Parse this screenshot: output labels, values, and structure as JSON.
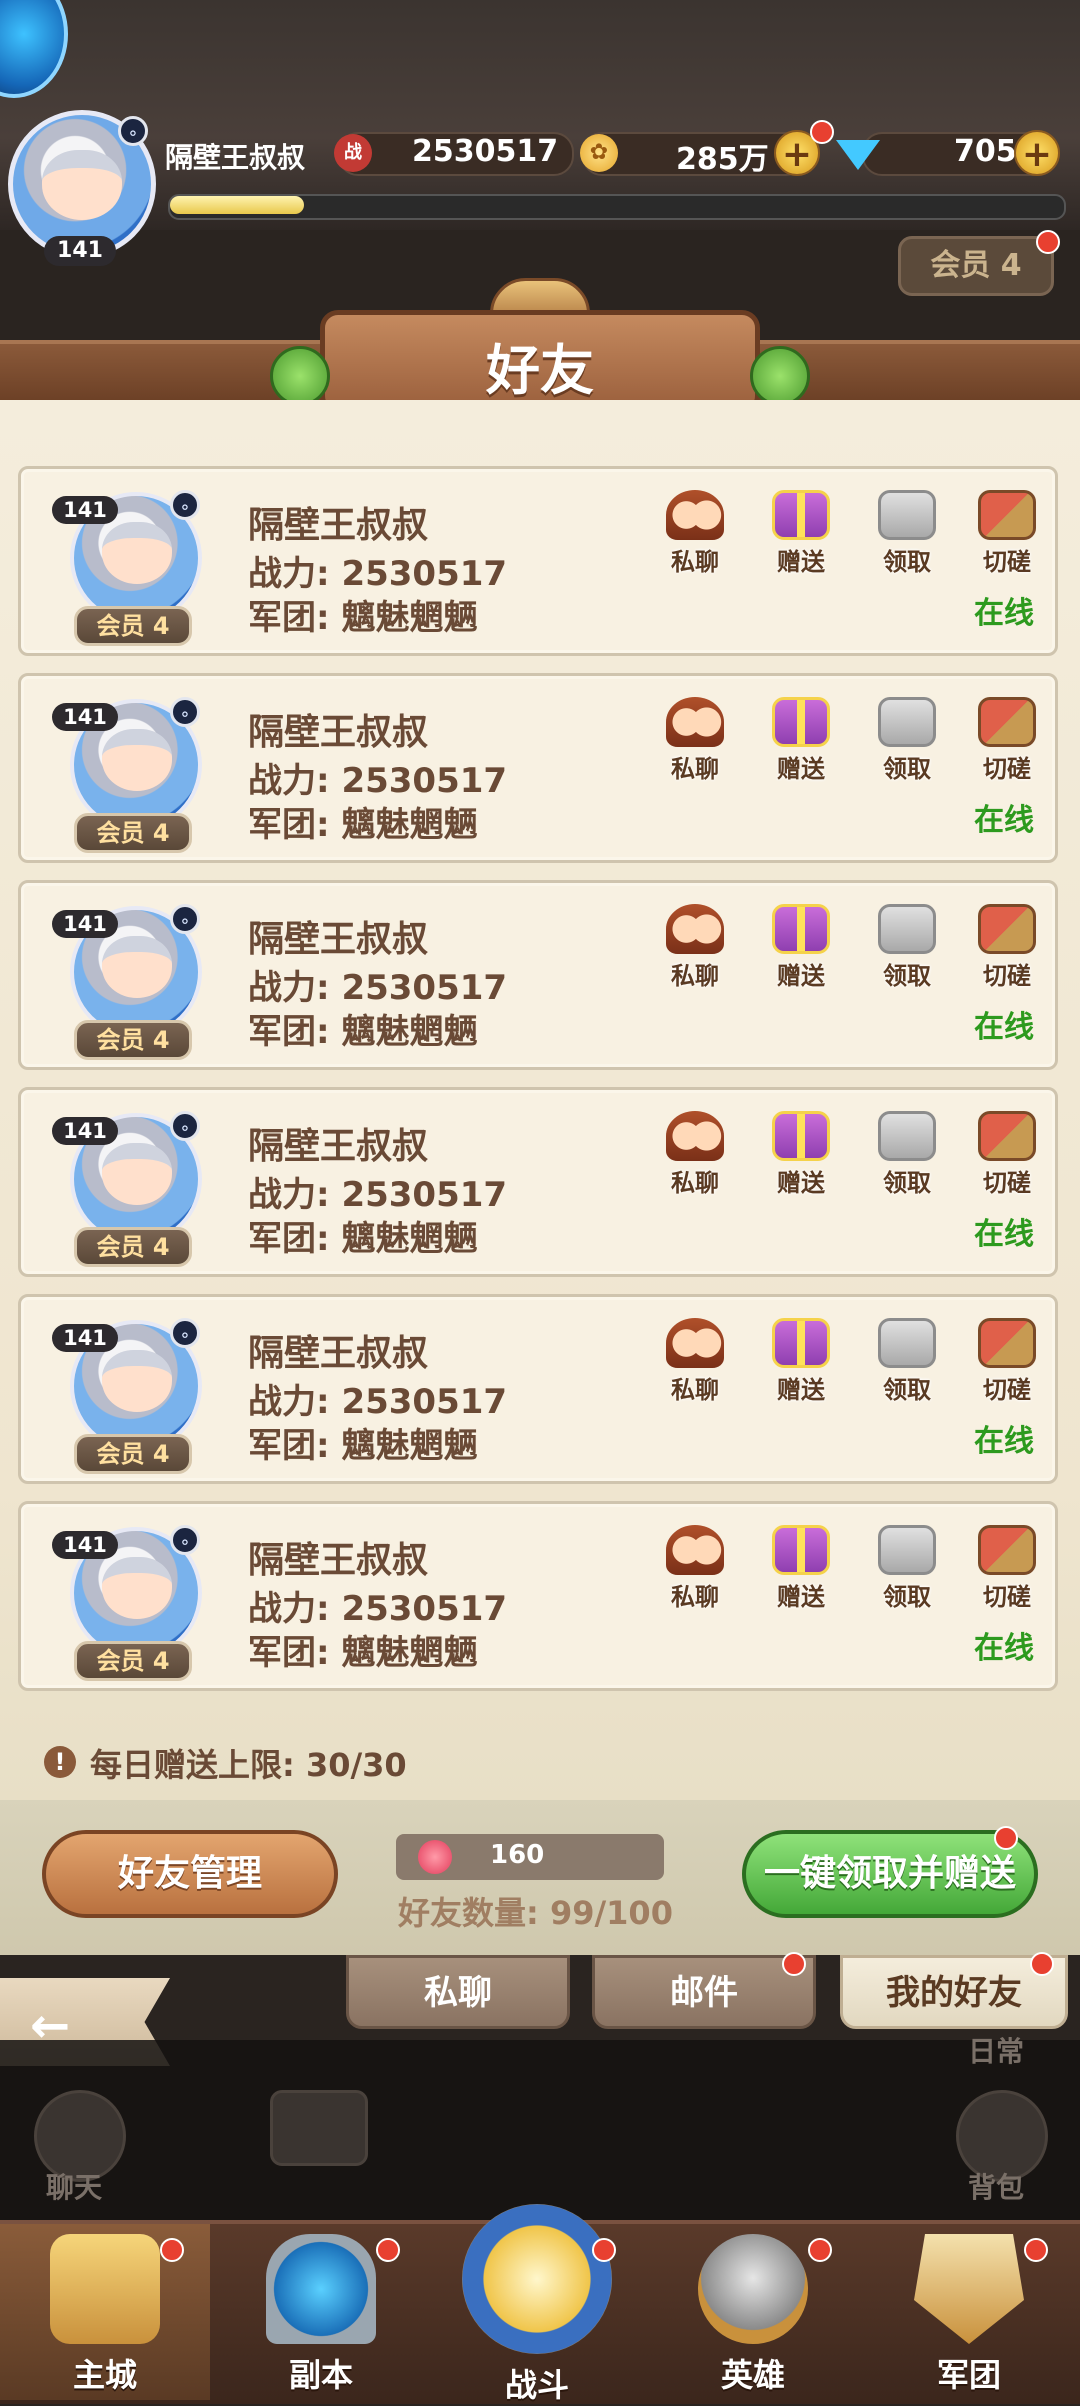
{
  "player": {
    "name": "隔壁王叔叔",
    "level": "141",
    "power": "2530517",
    "power_icon": "战",
    "gold": "285万",
    "gems": "705",
    "vip": "会员 4",
    "exp_fraction": 0.15
  },
  "title": "好友",
  "labels": {
    "power_prefix": "战力:",
    "legion_prefix": "军团:"
  },
  "actions": {
    "chat": "私聊",
    "gift": "赠送",
    "collect": "领取",
    "spar": "切磋"
  },
  "friends": [
    {
      "name": "隔壁王叔叔",
      "level": "141",
      "vip": "会员 4",
      "power": "2530517",
      "legion": "魑魅魍魉",
      "status": "在线"
    },
    {
      "name": "隔壁王叔叔",
      "level": "141",
      "vip": "会员 4",
      "power": "2530517",
      "legion": "魑魅魍魉",
      "status": "在线"
    },
    {
      "name": "隔壁王叔叔",
      "level": "141",
      "vip": "会员 4",
      "power": "2530517",
      "legion": "魑魅魍魉",
      "status": "在线"
    },
    {
      "name": "隔壁王叔叔",
      "level": "141",
      "vip": "会员 4",
      "power": "2530517",
      "legion": "魑魅魍魉",
      "status": "在线"
    },
    {
      "name": "隔壁王叔叔",
      "level": "141",
      "vip": "会员 4",
      "power": "2530517",
      "legion": "魑魅魍魉",
      "status": "在线"
    },
    {
      "name": "隔壁王叔叔",
      "level": "141",
      "vip": "会员 4",
      "power": "2530517",
      "legion": "魑魅魍魉",
      "status": "在线"
    }
  ],
  "daily_limit": "每日赠送上限: 30/30",
  "hearts": "160",
  "friend_count": "好友数量: 99/100",
  "buttons": {
    "manage": "好友管理",
    "claim_all": "一键领取并赠送"
  },
  "tabs": [
    "私聊",
    "邮件",
    "我的好友"
  ],
  "dim_labels": {
    "daily": "日常",
    "chat": "聊天",
    "bag": "背包"
  },
  "nav": [
    {
      "label": "主城",
      "icon": "castle-icon"
    },
    {
      "label": "副本",
      "icon": "portal-icon"
    },
    {
      "label": "战斗",
      "icon": "sword-emblem-icon"
    },
    {
      "label": "英雄",
      "icon": "knight-helmet-icon"
    },
    {
      "label": "军团",
      "icon": "legion-shield-icon"
    }
  ],
  "colors": {
    "accent_green": "#44a838",
    "accent_brown": "#b9713f",
    "online_green": "#2d9a1e",
    "text_brown": "#6a4a36"
  }
}
